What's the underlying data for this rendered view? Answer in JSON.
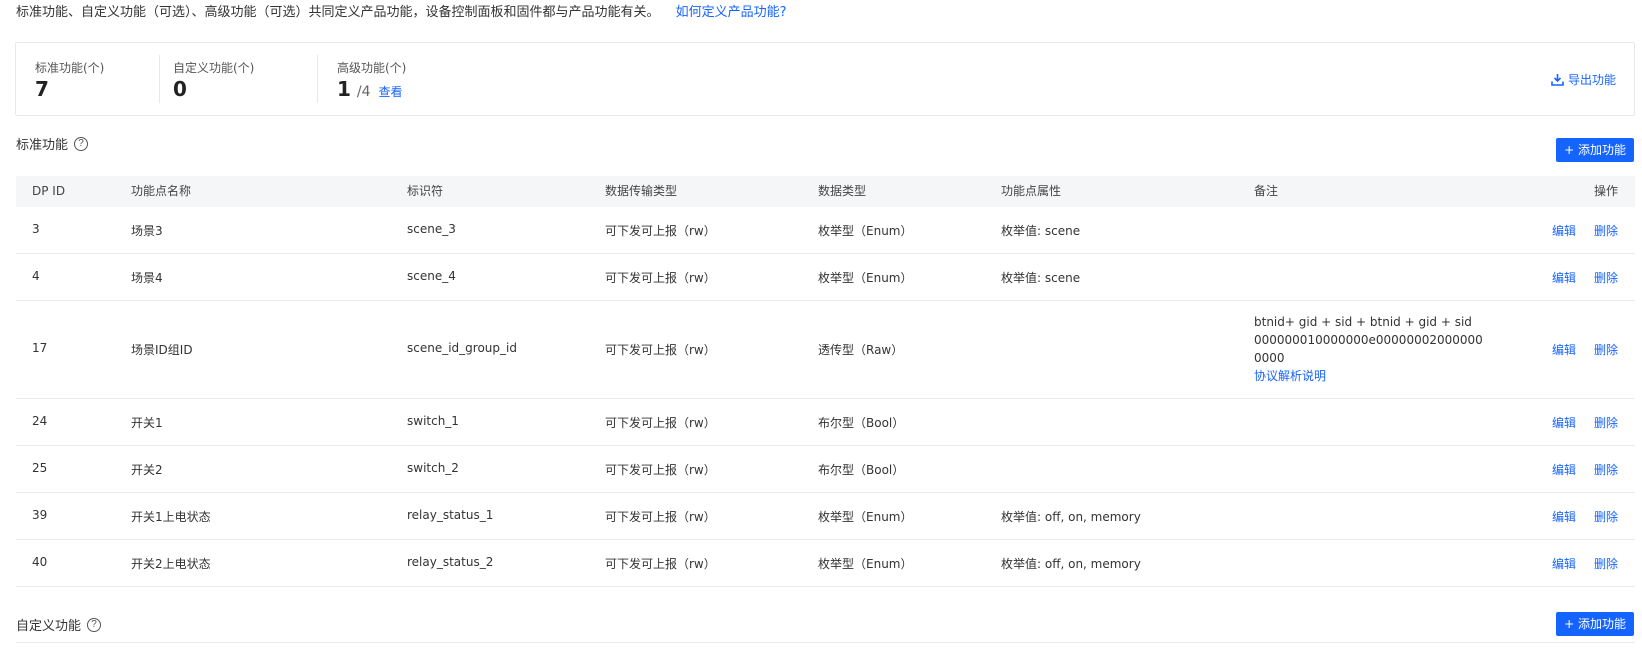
{
  "intro": {
    "text": "标准功能、自定义功能（可选）、高级功能（可选）共同定义产品功能，设备控制面板和固件都与产品功能有关。",
    "link": "如何定义产品功能?"
  },
  "stats": {
    "standard": {
      "label": "标准功能(个)",
      "value": "7"
    },
    "custom": {
      "label": "自定义功能(个)",
      "value": "0"
    },
    "advanced": {
      "label": "高级功能(个)",
      "value": "1",
      "total": "/4",
      "view": "查看"
    },
    "export": "导出功能"
  },
  "standard_section": {
    "title": "标准功能",
    "add": "+ 添加功能"
  },
  "custom_section": {
    "title": "自定义功能",
    "add": "+ 添加功能"
  },
  "table": {
    "headers": [
      "DP ID",
      "功能点名称",
      "标识符",
      "数据传输类型",
      "数据类型",
      "功能点属性",
      "备注",
      "操作"
    ],
    "rows": [
      {
        "id": "3",
        "name": "场景3",
        "code": "scene_3",
        "mode": "可下发可上报（rw）",
        "type": "枚举型（Enum）",
        "prop": "枚举值: scene",
        "edit": "编辑",
        "del": "删除"
      },
      {
        "id": "4",
        "name": "场景4",
        "code": "scene_4",
        "mode": "可下发可上报（rw）",
        "type": "枚举型（Enum）",
        "prop": "枚举值: scene",
        "edit": "编辑",
        "del": "删除"
      },
      {
        "id": "17",
        "name": "场景ID组ID",
        "code": "scene_id_group_id",
        "mode": "可下发可上报（rw）",
        "type": "透传型（Raw）",
        "prop": "",
        "note_line1": "btnid+ gid + sid + btnid + gid + sid",
        "note_line2": "000000010000000e00000002000000",
        "note_line3": "0000",
        "note_link": "协议解析说明",
        "edit": "编辑",
        "del": "删除"
      },
      {
        "id": "24",
        "name": "开关1",
        "code": "switch_1",
        "mode": "可下发可上报（rw）",
        "type": "布尔型（Bool）",
        "prop": "",
        "edit": "编辑",
        "del": "删除"
      },
      {
        "id": "25",
        "name": "开关2",
        "code": "switch_2",
        "mode": "可下发可上报（rw）",
        "type": "布尔型（Bool）",
        "prop": "",
        "edit": "编辑",
        "del": "删除"
      },
      {
        "id": "39",
        "name": "开关1上电状态",
        "code": "relay_status_1",
        "mode": "可下发可上报（rw）",
        "type": "枚举型（Enum）",
        "prop": "枚举值: off, on, memory",
        "edit": "编辑",
        "del": "删除"
      },
      {
        "id": "40",
        "name": "开关2上电状态",
        "code": "relay_status_2",
        "mode": "可下发可上报（rw）",
        "type": "枚举型（Enum）",
        "prop": "枚举值: off, on, memory",
        "edit": "编辑",
        "del": "删除"
      }
    ]
  },
  "colors": {
    "accent": "#1664ff",
    "header_bg": "#f5f6f8",
    "border": "#ebebeb"
  }
}
